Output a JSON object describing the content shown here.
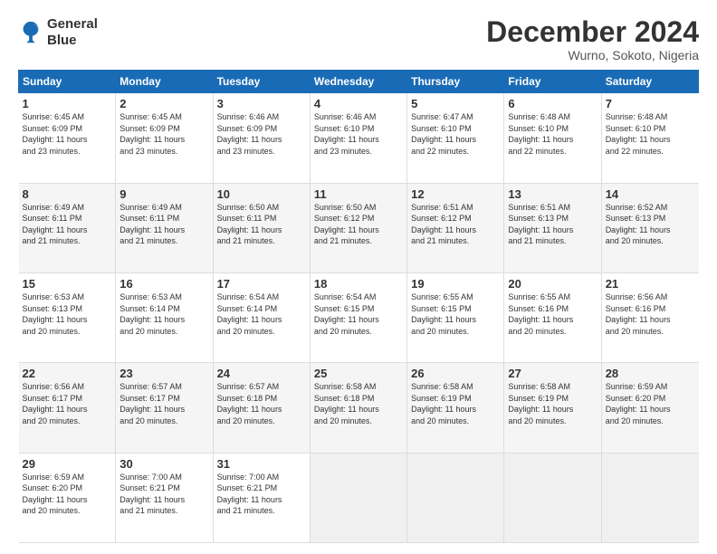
{
  "logo": {
    "line1": "General",
    "line2": "Blue"
  },
  "header": {
    "month": "December 2024",
    "location": "Wurno, Sokoto, Nigeria"
  },
  "weekdays": [
    "Sunday",
    "Monday",
    "Tuesday",
    "Wednesday",
    "Thursday",
    "Friday",
    "Saturday"
  ],
  "weeks": [
    [
      {
        "day": "1",
        "info": "Sunrise: 6:45 AM\nSunset: 6:09 PM\nDaylight: 11 hours\nand 23 minutes."
      },
      {
        "day": "2",
        "info": "Sunrise: 6:45 AM\nSunset: 6:09 PM\nDaylight: 11 hours\nand 23 minutes."
      },
      {
        "day": "3",
        "info": "Sunrise: 6:46 AM\nSunset: 6:09 PM\nDaylight: 11 hours\nand 23 minutes."
      },
      {
        "day": "4",
        "info": "Sunrise: 6:46 AM\nSunset: 6:10 PM\nDaylight: 11 hours\nand 23 minutes."
      },
      {
        "day": "5",
        "info": "Sunrise: 6:47 AM\nSunset: 6:10 PM\nDaylight: 11 hours\nand 22 minutes."
      },
      {
        "day": "6",
        "info": "Sunrise: 6:48 AM\nSunset: 6:10 PM\nDaylight: 11 hours\nand 22 minutes."
      },
      {
        "day": "7",
        "info": "Sunrise: 6:48 AM\nSunset: 6:10 PM\nDaylight: 11 hours\nand 22 minutes."
      }
    ],
    [
      {
        "day": "8",
        "info": "Sunrise: 6:49 AM\nSunset: 6:11 PM\nDaylight: 11 hours\nand 21 minutes."
      },
      {
        "day": "9",
        "info": "Sunrise: 6:49 AM\nSunset: 6:11 PM\nDaylight: 11 hours\nand 21 minutes."
      },
      {
        "day": "10",
        "info": "Sunrise: 6:50 AM\nSunset: 6:11 PM\nDaylight: 11 hours\nand 21 minutes."
      },
      {
        "day": "11",
        "info": "Sunrise: 6:50 AM\nSunset: 6:12 PM\nDaylight: 11 hours\nand 21 minutes."
      },
      {
        "day": "12",
        "info": "Sunrise: 6:51 AM\nSunset: 6:12 PM\nDaylight: 11 hours\nand 21 minutes."
      },
      {
        "day": "13",
        "info": "Sunrise: 6:51 AM\nSunset: 6:13 PM\nDaylight: 11 hours\nand 21 minutes."
      },
      {
        "day": "14",
        "info": "Sunrise: 6:52 AM\nSunset: 6:13 PM\nDaylight: 11 hours\nand 20 minutes."
      }
    ],
    [
      {
        "day": "15",
        "info": "Sunrise: 6:53 AM\nSunset: 6:13 PM\nDaylight: 11 hours\nand 20 minutes."
      },
      {
        "day": "16",
        "info": "Sunrise: 6:53 AM\nSunset: 6:14 PM\nDaylight: 11 hours\nand 20 minutes."
      },
      {
        "day": "17",
        "info": "Sunrise: 6:54 AM\nSunset: 6:14 PM\nDaylight: 11 hours\nand 20 minutes."
      },
      {
        "day": "18",
        "info": "Sunrise: 6:54 AM\nSunset: 6:15 PM\nDaylight: 11 hours\nand 20 minutes."
      },
      {
        "day": "19",
        "info": "Sunrise: 6:55 AM\nSunset: 6:15 PM\nDaylight: 11 hours\nand 20 minutes."
      },
      {
        "day": "20",
        "info": "Sunrise: 6:55 AM\nSunset: 6:16 PM\nDaylight: 11 hours\nand 20 minutes."
      },
      {
        "day": "21",
        "info": "Sunrise: 6:56 AM\nSunset: 6:16 PM\nDaylight: 11 hours\nand 20 minutes."
      }
    ],
    [
      {
        "day": "22",
        "info": "Sunrise: 6:56 AM\nSunset: 6:17 PM\nDaylight: 11 hours\nand 20 minutes."
      },
      {
        "day": "23",
        "info": "Sunrise: 6:57 AM\nSunset: 6:17 PM\nDaylight: 11 hours\nand 20 minutes."
      },
      {
        "day": "24",
        "info": "Sunrise: 6:57 AM\nSunset: 6:18 PM\nDaylight: 11 hours\nand 20 minutes."
      },
      {
        "day": "25",
        "info": "Sunrise: 6:58 AM\nSunset: 6:18 PM\nDaylight: 11 hours\nand 20 minutes."
      },
      {
        "day": "26",
        "info": "Sunrise: 6:58 AM\nSunset: 6:19 PM\nDaylight: 11 hours\nand 20 minutes."
      },
      {
        "day": "27",
        "info": "Sunrise: 6:58 AM\nSunset: 6:19 PM\nDaylight: 11 hours\nand 20 minutes."
      },
      {
        "day": "28",
        "info": "Sunrise: 6:59 AM\nSunset: 6:20 PM\nDaylight: 11 hours\nand 20 minutes."
      }
    ],
    [
      {
        "day": "29",
        "info": "Sunrise: 6:59 AM\nSunset: 6:20 PM\nDaylight: 11 hours\nand 20 minutes."
      },
      {
        "day": "30",
        "info": "Sunrise: 7:00 AM\nSunset: 6:21 PM\nDaylight: 11 hours\nand 21 minutes."
      },
      {
        "day": "31",
        "info": "Sunrise: 7:00 AM\nSunset: 6:21 PM\nDaylight: 11 hours\nand 21 minutes."
      },
      {
        "day": "",
        "info": ""
      },
      {
        "day": "",
        "info": ""
      },
      {
        "day": "",
        "info": ""
      },
      {
        "day": "",
        "info": ""
      }
    ]
  ]
}
